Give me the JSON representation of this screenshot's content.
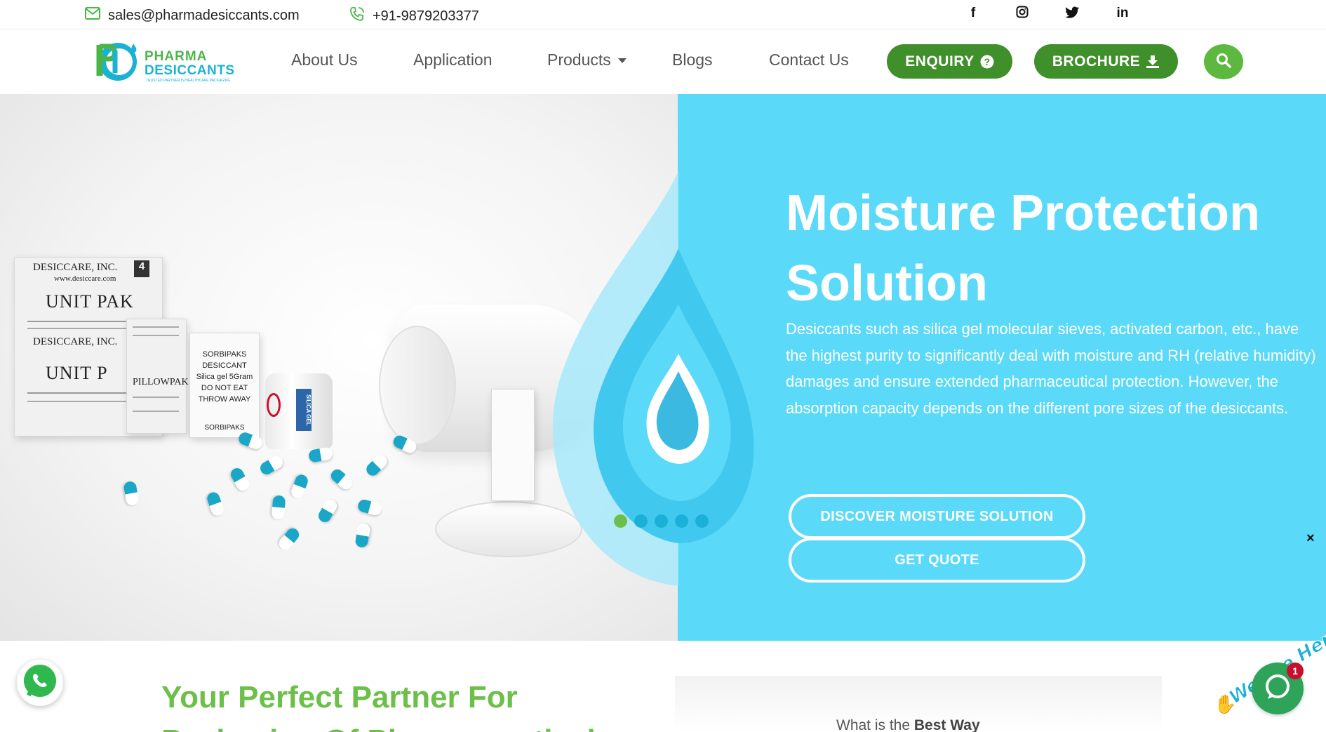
{
  "topbar": {
    "email": "sales@pharmadesiccants.com",
    "phone": "+91-9879203377",
    "social": [
      {
        "icon": "facebook-icon",
        "glyph": "f"
      },
      {
        "icon": "instagram-icon",
        "glyph": ""
      },
      {
        "icon": "twitter-icon",
        "glyph": ""
      },
      {
        "icon": "linkedin-icon",
        "glyph": "in"
      }
    ]
  },
  "logo": {
    "line1": "PHARMA",
    "line2": "DESICCANTS",
    "tagline": "TRUSTED PARTNER IN HEALTHCARE PACKAGING"
  },
  "nav": {
    "about": "About Us",
    "application": "Application",
    "products": "Products",
    "blogs": "Blogs",
    "contact": "Contact Us",
    "enquiry": "ENQUIRY",
    "brochure": "BROCHURE"
  },
  "hero": {
    "title": "Moisture Protection Solution",
    "description": "Desiccants such as silica gel molecular sieves, activated carbon, etc., have the highest purity to significantly deal with moisture and RH (relative humidity) damages and ensure extended pharmaceutical protection. However, the absorption capacity depends on the different pore sizes of the desiccants.",
    "btn_discover": "DISCOVER MOISTURE SOLUTION",
    "btn_quote": "GET QUOTE",
    "slides": 5,
    "active_slide": 1,
    "close": "×"
  },
  "product_image": {
    "pack1_brand": "DESICCARE, INC.",
    "pack1_site": "www.desiccare.com",
    "pack1_count": "4",
    "pack1_title": "UNIT PAK",
    "pack2_brand": "DESICCARE, INC.",
    "pack2_title": "UNIT P",
    "pack3_title": "PILLOWPAK",
    "sachet_lines": [
      "SORBIPAKS",
      "DESICCANT",
      "Silica gel 5Gram",
      "DO NOT EAT",
      "THROW AWAY"
    ],
    "sachet_footer": "SORBIPAKS",
    "jar_label": "SILICA GEL"
  },
  "lower": {
    "title": "Your Perfect Partner For Packaging Of Pharmaceutical",
    "video_prefix": "What is the ",
    "video_bold": "Best Way"
  },
  "widgets": {
    "chat_tagline": "We Are Here!",
    "chat_badge": "1"
  },
  "colors": {
    "brand_green": "#3f8f2a",
    "accent_green": "#6cc04a",
    "hero_blue": "#5ad9f8",
    "logo_blue": "#19b2d4",
    "dot_active": "#6cc04a",
    "dot_inactive": "#1ab0d8"
  }
}
